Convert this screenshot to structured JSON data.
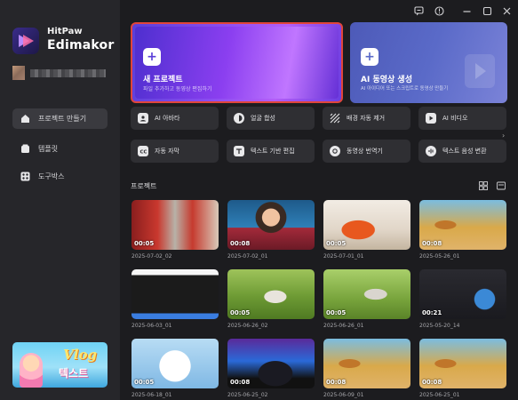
{
  "app": {
    "brand_top": "HitPaw",
    "brand_main": "Edimakor"
  },
  "sidebar": {
    "items": [
      {
        "label": "프로젝트 만들기",
        "icon": "home-icon",
        "active": true
      },
      {
        "label": "템플릿",
        "icon": "template-icon",
        "active": false
      },
      {
        "label": "도구박스",
        "icon": "toolbox-icon",
        "active": false
      }
    ],
    "promo": {
      "title": "Vlog",
      "subtitle": "텍스트"
    }
  },
  "titlebar": {
    "icons": [
      "feedback-icon",
      "info-icon",
      "minimize-icon",
      "maximize-icon",
      "close-icon"
    ]
  },
  "hero": {
    "new_project": {
      "title": "새 프로젝트",
      "subtitle": "파일 추가하고 동영상 편집하기"
    },
    "ai_video": {
      "title": "AI 동영상 생성",
      "subtitle": "AI 아이디어 또는 스크립트로 동영상 만들기"
    }
  },
  "tools": [
    {
      "label": "AI 아바타",
      "icon": "avatar-icon"
    },
    {
      "label": "얼굴 합성",
      "icon": "face-swap-icon"
    },
    {
      "label": "배경 자동 제거",
      "icon": "background-remove-icon"
    },
    {
      "label": "AI 비디오",
      "icon": "ai-video-icon"
    },
    {
      "label": "자동 자막",
      "icon": "subtitle-icon"
    },
    {
      "label": "텍스트 기반 편집",
      "icon": "text-edit-icon"
    },
    {
      "label": "동영상 번역기",
      "icon": "translate-icon"
    },
    {
      "label": "텍스트 음성 변환",
      "icon": "tts-icon"
    }
  ],
  "projects": {
    "title": "프로젝트",
    "items": [
      {
        "name": "2025-07-02_02",
        "duration": "00:05",
        "theme": "red"
      },
      {
        "name": "2025-07-02_01",
        "duration": "00:08",
        "theme": "doll"
      },
      {
        "name": "2025-07-01_01",
        "duration": "00:05",
        "theme": "cook"
      },
      {
        "name": "2025-05-26_01",
        "duration": "00:08",
        "theme": "beach"
      },
      {
        "name": "2025-06-03_01",
        "duration": "",
        "theme": "editor"
      },
      {
        "name": "2025-06-26_02",
        "duration": "00:05",
        "theme": "grass"
      },
      {
        "name": "2025-06-26_01",
        "duration": "00:05",
        "theme": "grass2"
      },
      {
        "name": "2025-05-20_14",
        "duration": "00:21",
        "theme": "dark"
      },
      {
        "name": "2025-06-18_01",
        "duration": "00:05",
        "theme": "cat"
      },
      {
        "name": "2025-06-25_02",
        "duration": "00:08",
        "theme": "gamer"
      },
      {
        "name": "2025-06-09_01",
        "duration": "00:08",
        "theme": "beach"
      },
      {
        "name": "2025-06-25_01",
        "duration": "00:08",
        "theme": "beach"
      }
    ]
  },
  "colors": {
    "accent": "#8b3ff0",
    "highlight_border": "#e0453b",
    "panel": "#26262a",
    "background": "#1c1c1f"
  }
}
